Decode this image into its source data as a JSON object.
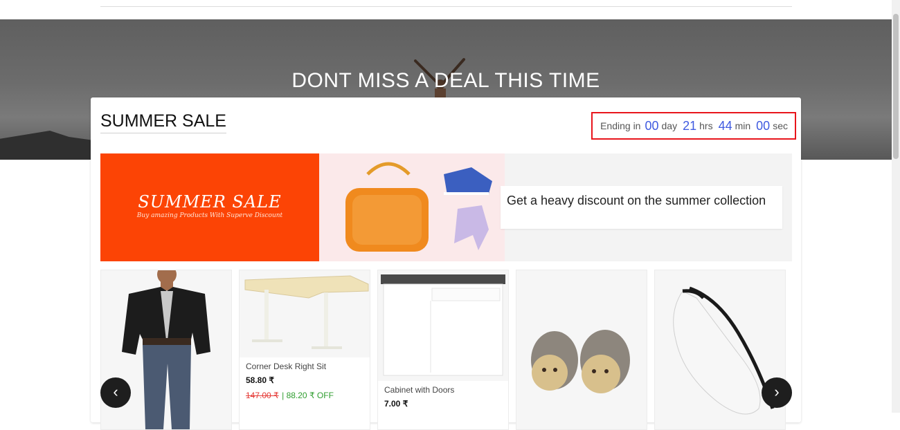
{
  "hero": {
    "title": "DONT MISS A DEAL THIS TIME"
  },
  "sale": {
    "title": "SUMMER SALE",
    "countdown": {
      "prefix": "Ending in",
      "days": "00",
      "days_label": "day",
      "hours": "21",
      "hours_label": "hrs",
      "minutes": "44",
      "minutes_label": "min",
      "seconds": "00",
      "seconds_label": "sec",
      "highlight_color": "#e8141b",
      "number_color": "#3f5ae0"
    },
    "banner": {
      "title": "SUMMER SALE",
      "subtitle": "Buy amazing Products With Superve Discount",
      "description": "Get a heavy discount on the summer collection",
      "accent_color": "#fc4405"
    },
    "products": [
      {
        "name": "",
        "price": "",
        "mrp": "",
        "off": ""
      },
      {
        "name": "Corner Desk Right Sit",
        "price": "58.80 ₹",
        "mrp": "147.00 ₹",
        "off": "| 88.20 ₹ OFF"
      },
      {
        "name": "Cabinet with Doors",
        "price": "7.00 ₹",
        "mrp": "",
        "off": ""
      },
      {
        "name": "",
        "price": "",
        "mrp": "",
        "off": ""
      },
      {
        "name": "",
        "price": "",
        "mrp": "",
        "off": ""
      }
    ],
    "carousel": {
      "prev_label": "‹",
      "next_label": "›"
    }
  }
}
